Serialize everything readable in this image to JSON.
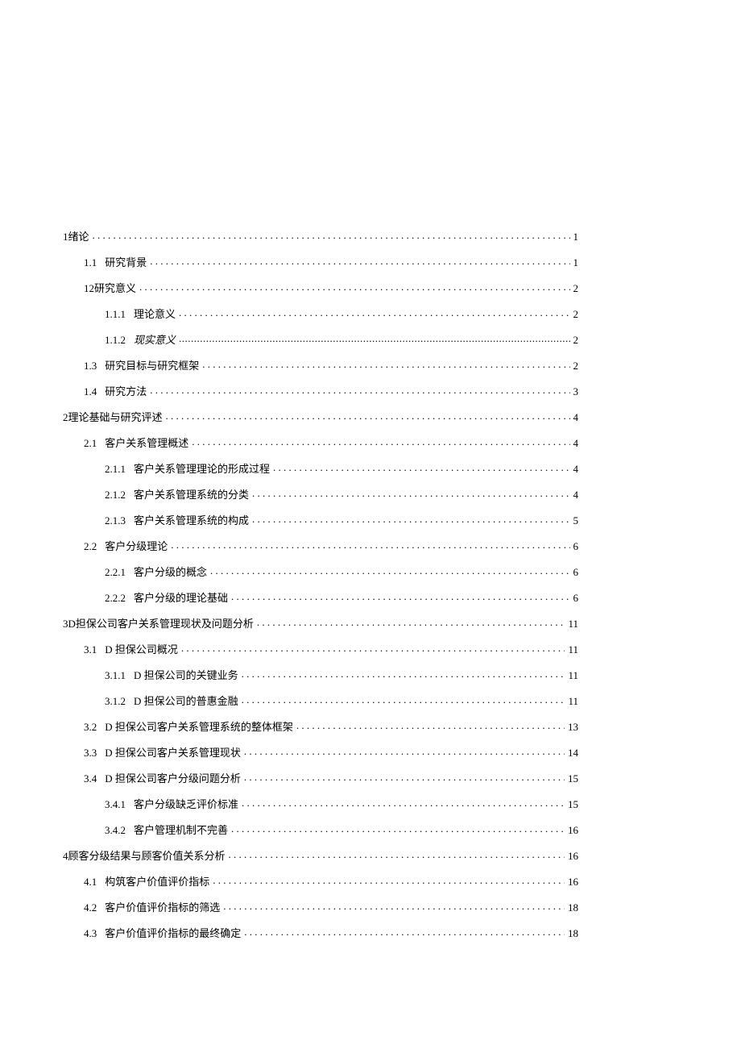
{
  "toc": [
    {
      "level": 0,
      "num": "1",
      "title": "绪论",
      "page": "1",
      "nosep": true,
      "italic": false,
      "fine": false
    },
    {
      "level": 1,
      "num": "1.1",
      "title": "研究背景",
      "page": "1",
      "nosep": false,
      "italic": false,
      "fine": false
    },
    {
      "level": 1,
      "num": "12",
      "title": "研究意义",
      "page": "2",
      "nosep": true,
      "italic": false,
      "fine": false
    },
    {
      "level": 2,
      "num": "1.1.1",
      "title": "理论意义",
      "page": "2",
      "nosep": false,
      "italic": false,
      "fine": false
    },
    {
      "level": 2,
      "num": "1.1.2",
      "title": "现实意义",
      "page": "2",
      "nosep": false,
      "italic": true,
      "fine": true
    },
    {
      "level": 1,
      "num": "1.3",
      "title": "研究目标与研究框架",
      "page": "2",
      "nosep": false,
      "italic": false,
      "fine": false
    },
    {
      "level": 1,
      "num": "1.4",
      "title": "研究方法",
      "page": "3",
      "nosep": false,
      "italic": false,
      "fine": false
    },
    {
      "level": 0,
      "num": "2",
      "title": "理论基础与研究评述",
      "page": "4",
      "nosep": true,
      "italic": false,
      "fine": false
    },
    {
      "level": 1,
      "num": "2.1",
      "title": "客户关系管理概述",
      "page": "4",
      "nosep": false,
      "italic": false,
      "fine": false
    },
    {
      "level": 2,
      "num": "2.1.1",
      "title": "客户关系管理理论的形成过程",
      "page": "4",
      "nosep": false,
      "italic": false,
      "fine": false
    },
    {
      "level": 2,
      "num": "2.1.2",
      "title": "客户关系管理系统的分类",
      "page": "4",
      "nosep": false,
      "italic": false,
      "fine": false
    },
    {
      "level": 2,
      "num": "2.1.3",
      "title": "客户关系管理系统的构成",
      "page": "5",
      "nosep": false,
      "italic": false,
      "fine": false
    },
    {
      "level": 1,
      "num": "2.2",
      "title": "客户分级理论",
      "page": "6",
      "nosep": false,
      "italic": false,
      "fine": false
    },
    {
      "level": 2,
      "num": "2.2.1",
      "title": "客户分级的概念",
      "page": "6",
      "nosep": false,
      "italic": false,
      "fine": false
    },
    {
      "level": 2,
      "num": "2.2.2",
      "title": "客户分级的理论基础",
      "page": "6",
      "nosep": false,
      "italic": false,
      "fine": false
    },
    {
      "level": 0,
      "num": "3D",
      "title": " 担保公司客户关系管理现状及问题分析",
      "page": "11",
      "nosep": true,
      "italic": false,
      "fine": false
    },
    {
      "level": 1,
      "num": "3.1",
      "title": "D 担保公司概况",
      "page": "11",
      "nosep": false,
      "italic": false,
      "fine": false
    },
    {
      "level": 2,
      "num": "3.1.1",
      "title": "D 担保公司的关键业务",
      "page": "11",
      "nosep": false,
      "italic": false,
      "fine": false
    },
    {
      "level": 2,
      "num": "3.1.2",
      "title": "D 担保公司的普惠金融",
      "page": "11",
      "nosep": false,
      "italic": false,
      "fine": false
    },
    {
      "level": 1,
      "num": "3.2",
      "title": "D 担保公司客户关系管理系统的整体框架",
      "page": "13",
      "nosep": false,
      "italic": false,
      "fine": false
    },
    {
      "level": 1,
      "num": "3.3",
      "title": "D 担保公司客户关系管理现状",
      "page": "14",
      "nosep": false,
      "italic": false,
      "fine": false
    },
    {
      "level": 1,
      "num": "3.4",
      "title": "D 担保公司客户分级问题分析",
      "page": "15",
      "nosep": false,
      "italic": false,
      "fine": false
    },
    {
      "level": 2,
      "num": "3.4.1",
      "title": "客户分级缺乏评价标准",
      "page": "15",
      "nosep": false,
      "italic": false,
      "fine": false
    },
    {
      "level": 2,
      "num": "3.4.2",
      "title": "客户管理机制不完善",
      "page": "16",
      "nosep": false,
      "italic": false,
      "fine": false
    },
    {
      "level": 0,
      "num": "4",
      "title": "顾客分级结果与顾客价值关系分析",
      "page": "16",
      "nosep": true,
      "italic": false,
      "fine": false
    },
    {
      "level": 1,
      "num": "4.1",
      "title": "构筑客户价值评价指标",
      "page": "16",
      "nosep": false,
      "italic": false,
      "fine": false
    },
    {
      "level": 1,
      "num": "4.2",
      "title": "客户价值评价指标的筛选",
      "page": "18",
      "nosep": false,
      "italic": false,
      "fine": false
    },
    {
      "level": 1,
      "num": "4.3",
      "title": "客户价值评价指标的最终确定",
      "page": "18",
      "nosep": false,
      "italic": false,
      "fine": false
    }
  ]
}
